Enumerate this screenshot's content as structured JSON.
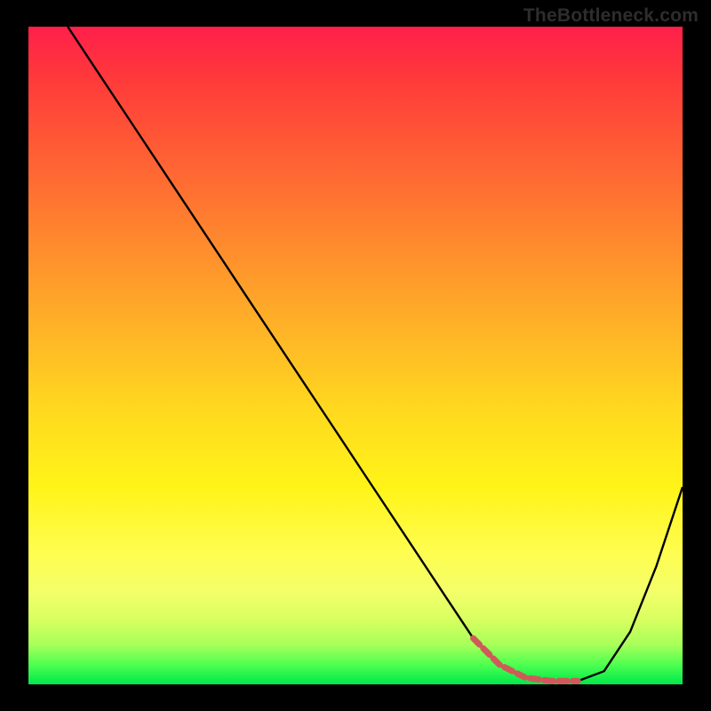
{
  "branding": "TheBottleneck.com",
  "chart_data": {
    "type": "line",
    "title": "",
    "xlabel": "",
    "ylabel": "",
    "xlim": [
      0,
      100
    ],
    "ylim": [
      0,
      100
    ],
    "x": [
      6,
      10,
      16,
      22,
      28,
      34,
      40,
      46,
      52,
      58,
      64,
      68,
      72,
      76,
      80,
      84,
      88,
      92,
      96,
      100
    ],
    "values": [
      100,
      94,
      85,
      76,
      67,
      58,
      49,
      40,
      31,
      22,
      13,
      7,
      3,
      1,
      0.5,
      0.5,
      2,
      8,
      18,
      30
    ],
    "marker_segment_x": [
      68,
      84
    ],
    "annotations": []
  },
  "colors": {
    "curve": "#000000",
    "marker": "#cf5a5a",
    "frame_bg": "#000000"
  }
}
